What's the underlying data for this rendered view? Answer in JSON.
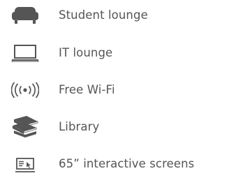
{
  "colors": {
    "icon": "#555555",
    "text": "#555555",
    "background": "#ffffff"
  },
  "amenities": [
    {
      "label": "Student lounge",
      "icon": "sofa-icon"
    },
    {
      "label": "IT lounge",
      "icon": "laptop-icon"
    },
    {
      "label": "Free Wi-Fi",
      "icon": "wifi-signal-icon"
    },
    {
      "label": "Library",
      "icon": "books-stack-icon"
    },
    {
      "label": "65” interactive screens",
      "icon": "interactive-screen-icon"
    }
  ]
}
